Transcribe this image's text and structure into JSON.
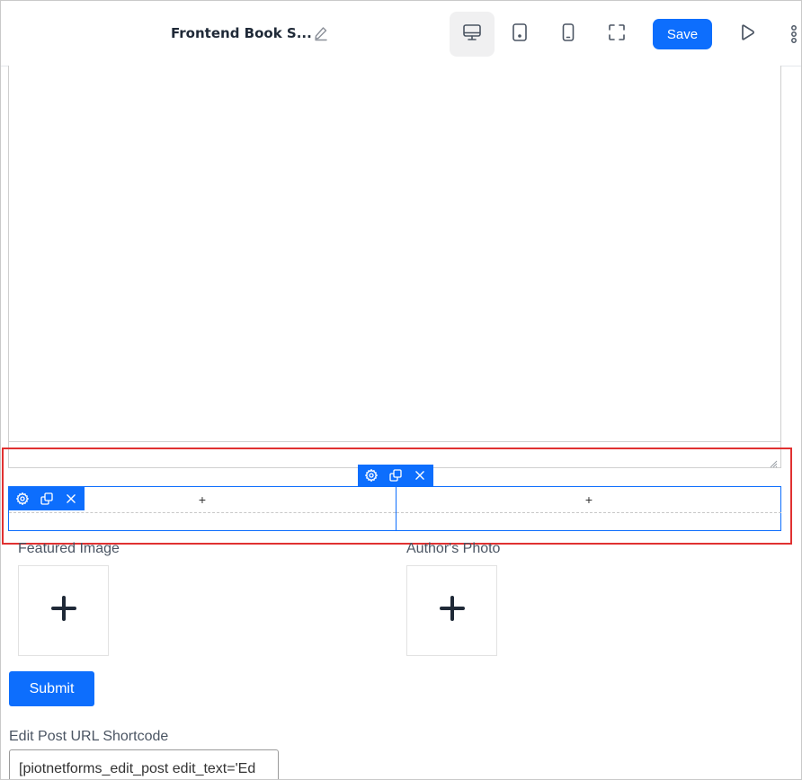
{
  "header": {
    "title": "Frontend Book S...",
    "save_label": "Save"
  },
  "icons": {
    "edit_title": "pencil-icon",
    "desktop": "desktop-icon",
    "tablet": "tablet-icon",
    "mobile": "mobile-icon",
    "fullscreen": "fullscreen-icon",
    "preview": "play-icon",
    "more": "more-vertical-icon"
  },
  "section": {
    "column_add_1": "+",
    "column_add_2": "+"
  },
  "form": {
    "featured_image_label": "Featured Image",
    "author_photo_label": "Author's Photo",
    "submit_label": "Submit",
    "shortcode_label": "Edit Post URL Shortcode",
    "shortcode_value": "[piotnetforms_edit_post edit_text='Ed"
  },
  "colors": {
    "accent": "#0d6efd",
    "highlight": "#e03131"
  }
}
